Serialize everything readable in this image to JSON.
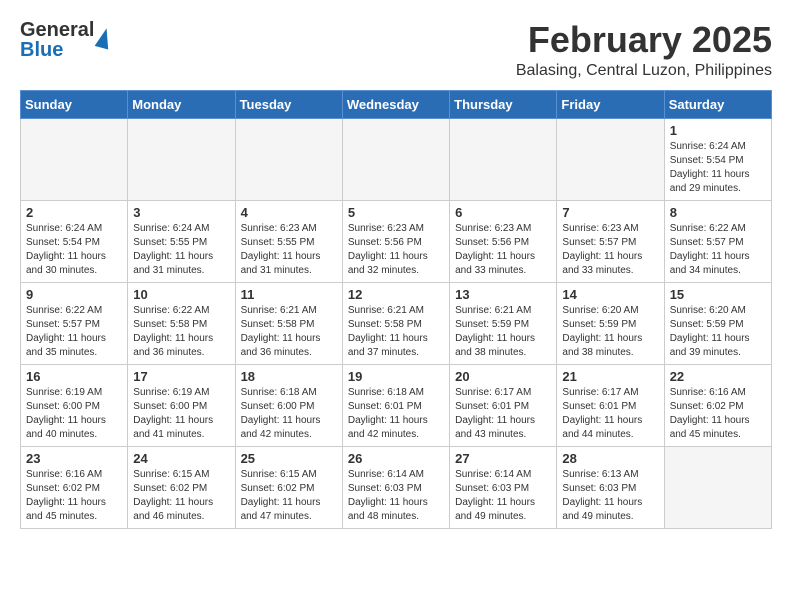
{
  "header": {
    "logo_general": "General",
    "logo_blue": "Blue",
    "month_title": "February 2025",
    "location": "Balasing, Central Luzon, Philippines"
  },
  "days_of_week": [
    "Sunday",
    "Monday",
    "Tuesday",
    "Wednesday",
    "Thursday",
    "Friday",
    "Saturday"
  ],
  "weeks": [
    [
      {
        "day": "",
        "info": ""
      },
      {
        "day": "",
        "info": ""
      },
      {
        "day": "",
        "info": ""
      },
      {
        "day": "",
        "info": ""
      },
      {
        "day": "",
        "info": ""
      },
      {
        "day": "",
        "info": ""
      },
      {
        "day": "1",
        "info": "Sunrise: 6:24 AM\nSunset: 5:54 PM\nDaylight: 11 hours\nand 29 minutes."
      }
    ],
    [
      {
        "day": "2",
        "info": "Sunrise: 6:24 AM\nSunset: 5:54 PM\nDaylight: 11 hours\nand 30 minutes."
      },
      {
        "day": "3",
        "info": "Sunrise: 6:24 AM\nSunset: 5:55 PM\nDaylight: 11 hours\nand 31 minutes."
      },
      {
        "day": "4",
        "info": "Sunrise: 6:23 AM\nSunset: 5:55 PM\nDaylight: 11 hours\nand 31 minutes."
      },
      {
        "day": "5",
        "info": "Sunrise: 6:23 AM\nSunset: 5:56 PM\nDaylight: 11 hours\nand 32 minutes."
      },
      {
        "day": "6",
        "info": "Sunrise: 6:23 AM\nSunset: 5:56 PM\nDaylight: 11 hours\nand 33 minutes."
      },
      {
        "day": "7",
        "info": "Sunrise: 6:23 AM\nSunset: 5:57 PM\nDaylight: 11 hours\nand 33 minutes."
      },
      {
        "day": "8",
        "info": "Sunrise: 6:22 AM\nSunset: 5:57 PM\nDaylight: 11 hours\nand 34 minutes."
      }
    ],
    [
      {
        "day": "9",
        "info": "Sunrise: 6:22 AM\nSunset: 5:57 PM\nDaylight: 11 hours\nand 35 minutes."
      },
      {
        "day": "10",
        "info": "Sunrise: 6:22 AM\nSunset: 5:58 PM\nDaylight: 11 hours\nand 36 minutes."
      },
      {
        "day": "11",
        "info": "Sunrise: 6:21 AM\nSunset: 5:58 PM\nDaylight: 11 hours\nand 36 minutes."
      },
      {
        "day": "12",
        "info": "Sunrise: 6:21 AM\nSunset: 5:58 PM\nDaylight: 11 hours\nand 37 minutes."
      },
      {
        "day": "13",
        "info": "Sunrise: 6:21 AM\nSunset: 5:59 PM\nDaylight: 11 hours\nand 38 minutes."
      },
      {
        "day": "14",
        "info": "Sunrise: 6:20 AM\nSunset: 5:59 PM\nDaylight: 11 hours\nand 38 minutes."
      },
      {
        "day": "15",
        "info": "Sunrise: 6:20 AM\nSunset: 5:59 PM\nDaylight: 11 hours\nand 39 minutes."
      }
    ],
    [
      {
        "day": "16",
        "info": "Sunrise: 6:19 AM\nSunset: 6:00 PM\nDaylight: 11 hours\nand 40 minutes."
      },
      {
        "day": "17",
        "info": "Sunrise: 6:19 AM\nSunset: 6:00 PM\nDaylight: 11 hours\nand 41 minutes."
      },
      {
        "day": "18",
        "info": "Sunrise: 6:18 AM\nSunset: 6:00 PM\nDaylight: 11 hours\nand 42 minutes."
      },
      {
        "day": "19",
        "info": "Sunrise: 6:18 AM\nSunset: 6:01 PM\nDaylight: 11 hours\nand 42 minutes."
      },
      {
        "day": "20",
        "info": "Sunrise: 6:17 AM\nSunset: 6:01 PM\nDaylight: 11 hours\nand 43 minutes."
      },
      {
        "day": "21",
        "info": "Sunrise: 6:17 AM\nSunset: 6:01 PM\nDaylight: 11 hours\nand 44 minutes."
      },
      {
        "day": "22",
        "info": "Sunrise: 6:16 AM\nSunset: 6:02 PM\nDaylight: 11 hours\nand 45 minutes."
      }
    ],
    [
      {
        "day": "23",
        "info": "Sunrise: 6:16 AM\nSunset: 6:02 PM\nDaylight: 11 hours\nand 45 minutes."
      },
      {
        "day": "24",
        "info": "Sunrise: 6:15 AM\nSunset: 6:02 PM\nDaylight: 11 hours\nand 46 minutes."
      },
      {
        "day": "25",
        "info": "Sunrise: 6:15 AM\nSunset: 6:02 PM\nDaylight: 11 hours\nand 47 minutes."
      },
      {
        "day": "26",
        "info": "Sunrise: 6:14 AM\nSunset: 6:03 PM\nDaylight: 11 hours\nand 48 minutes."
      },
      {
        "day": "27",
        "info": "Sunrise: 6:14 AM\nSunset: 6:03 PM\nDaylight: 11 hours\nand 49 minutes."
      },
      {
        "day": "28",
        "info": "Sunrise: 6:13 AM\nSunset: 6:03 PM\nDaylight: 11 hours\nand 49 minutes."
      },
      {
        "day": "",
        "info": ""
      }
    ]
  ]
}
